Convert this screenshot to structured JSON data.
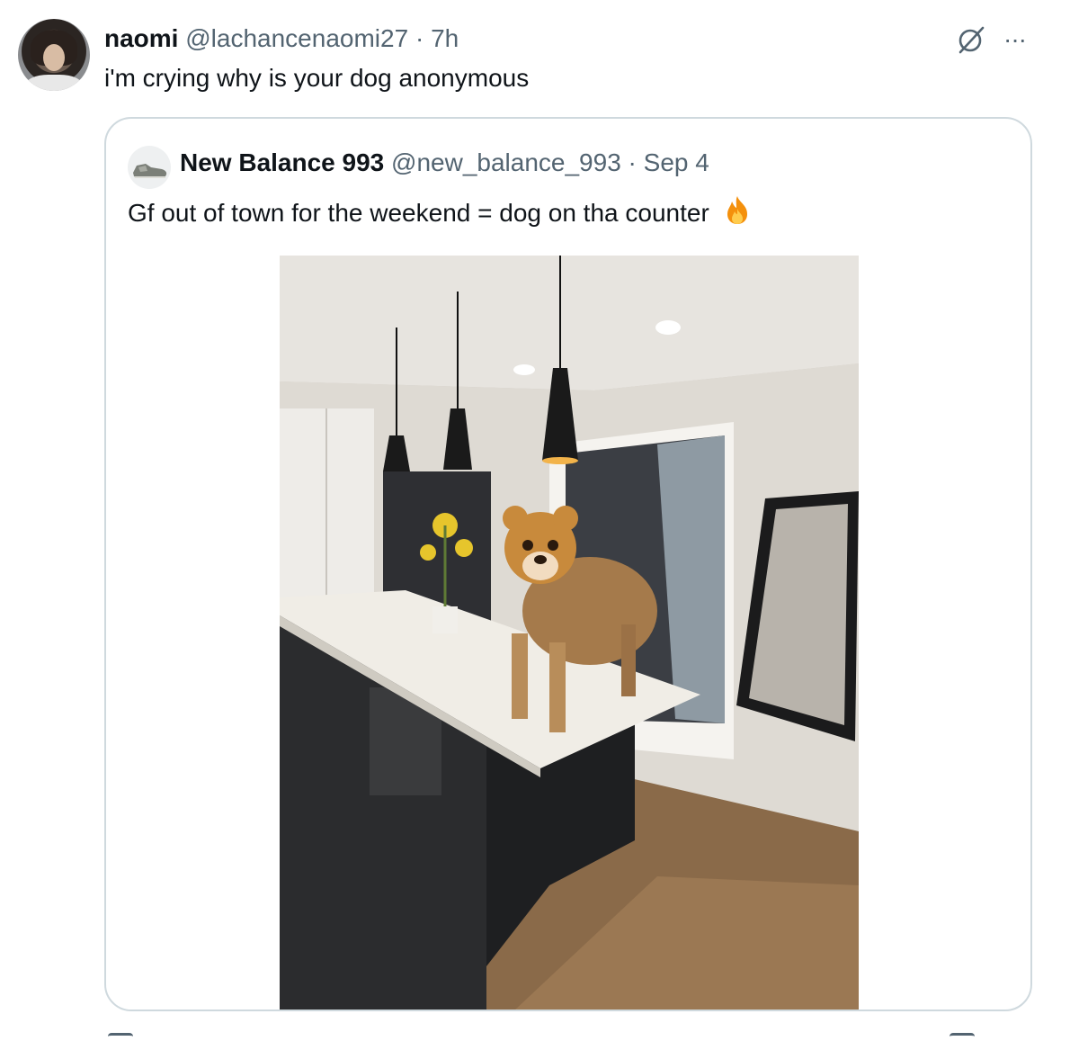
{
  "tweet": {
    "author_name": "naomi",
    "handle": "@lachancenaomi27",
    "separator": "·",
    "time": "7h",
    "text": "i'm crying why is your dog anonymous",
    "more_label": "···"
  },
  "quoted_tweet": {
    "author_name": "New Balance 993",
    "handle": "@new_balance_993",
    "separator": "·",
    "date": "Sep 4",
    "text": "Gf out of town for the weekend = dog on tha counter"
  },
  "icons": {
    "tweet_avatar": "user-avatar",
    "grok": "grok-icon",
    "more": "more-icon",
    "quoted_avatar": "sneaker-avatar",
    "emoji": "fire-icon",
    "photo": "kitchen-dog-photo"
  },
  "colors": {
    "text_primary": "#0f1419",
    "text_secondary": "#536471",
    "border": "#cfd9de"
  }
}
